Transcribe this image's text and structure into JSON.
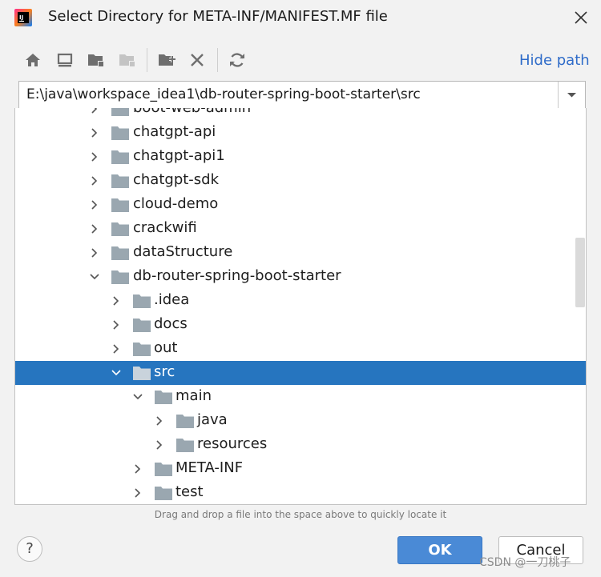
{
  "window": {
    "title": "Select Directory for META-INF/MANIFEST.MF file",
    "app_icon": "intellij-idea-icon",
    "close_icon": "close-icon"
  },
  "toolbar": {
    "buttons": [
      "home-icon",
      "desktop-icon",
      "project-folder-icon",
      "module-folder-icon",
      "new-folder-icon",
      "delete-icon",
      "refresh-icon"
    ],
    "hide_path_label": "Hide path"
  },
  "path": {
    "value": "E:\\java\\workspace_idea1\\db-router-spring-boot-starter\\src",
    "dropdown_icon": "chevron-down-icon"
  },
  "tree": {
    "items": [
      {
        "label": "boot-web-admin",
        "expanded": false
      },
      {
        "label": "chatgpt-api",
        "expanded": false
      },
      {
        "label": "chatgpt-api1",
        "expanded": false
      },
      {
        "label": "chatgpt-sdk",
        "expanded": false
      },
      {
        "label": "cloud-demo",
        "expanded": false
      },
      {
        "label": "crackwifi",
        "expanded": false
      },
      {
        "label": "dataStructure",
        "expanded": false
      },
      {
        "label": "db-router-spring-boot-starter",
        "expanded": true
      },
      {
        "label": ".idea",
        "expanded": false
      },
      {
        "label": "docs",
        "expanded": false
      },
      {
        "label": "out",
        "expanded": false
      },
      {
        "label": "src",
        "expanded": true,
        "selected": true
      },
      {
        "label": "main",
        "expanded": true
      },
      {
        "label": "java",
        "expanded": false
      },
      {
        "label": "resources",
        "expanded": false
      },
      {
        "label": "META-INF",
        "expanded": false
      },
      {
        "label": "test",
        "expanded": false
      }
    ]
  },
  "hint": "Drag and drop a file into the space above to quickly locate it",
  "buttons": {
    "help": "?",
    "ok": "OK",
    "cancel": "Cancel"
  },
  "watermark": "CSDN @一刀桃子",
  "colors": {
    "selection": "#2675bf",
    "link": "#2f6cc9",
    "ok_button": "#4a8ad6",
    "folder": "#9aa7b0"
  }
}
